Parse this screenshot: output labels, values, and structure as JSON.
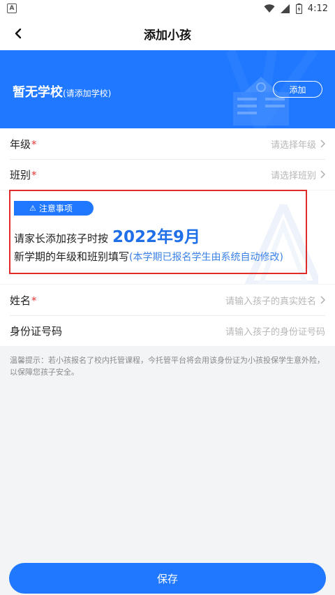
{
  "status_bar": {
    "app_glyph": "A",
    "time": "4:12"
  },
  "nav": {
    "title": "添加小孩",
    "back_icon": "arrow-left-icon"
  },
  "school": {
    "name": "暂无学校",
    "hint": "(请添加学校)",
    "add_label": "添加"
  },
  "class_fields": [
    {
      "label": "年级",
      "placeholder": "请选择年级",
      "required": "*"
    },
    {
      "label": "班别",
      "placeholder": "请选择班别",
      "required": "*"
    }
  ],
  "notice": {
    "tag": "注意事项",
    "line1_prefix": "请家长添加孩子时按",
    "date": "2022年9月",
    "line2_main": "新学期的年级和班别填写",
    "line2_sub": "(本学期已报名学生由系统自动修改)"
  },
  "child_fields": [
    {
      "label": "姓名",
      "placeholder": "请输入孩子的真实姓名",
      "required": "*"
    },
    {
      "label": "身份证号码",
      "placeholder": "请输入孩子的身份证号码"
    }
  ],
  "tip": "温馨提示：若小孩报名了校内托管课程，今托管平台将会用该身份证为小孩投保学生意外险，以保障您孩子安全。",
  "save_label": "保存",
  "colors": {
    "primary": "#1f78ff",
    "required": "#e53935",
    "highlight": "#e02b2b"
  }
}
